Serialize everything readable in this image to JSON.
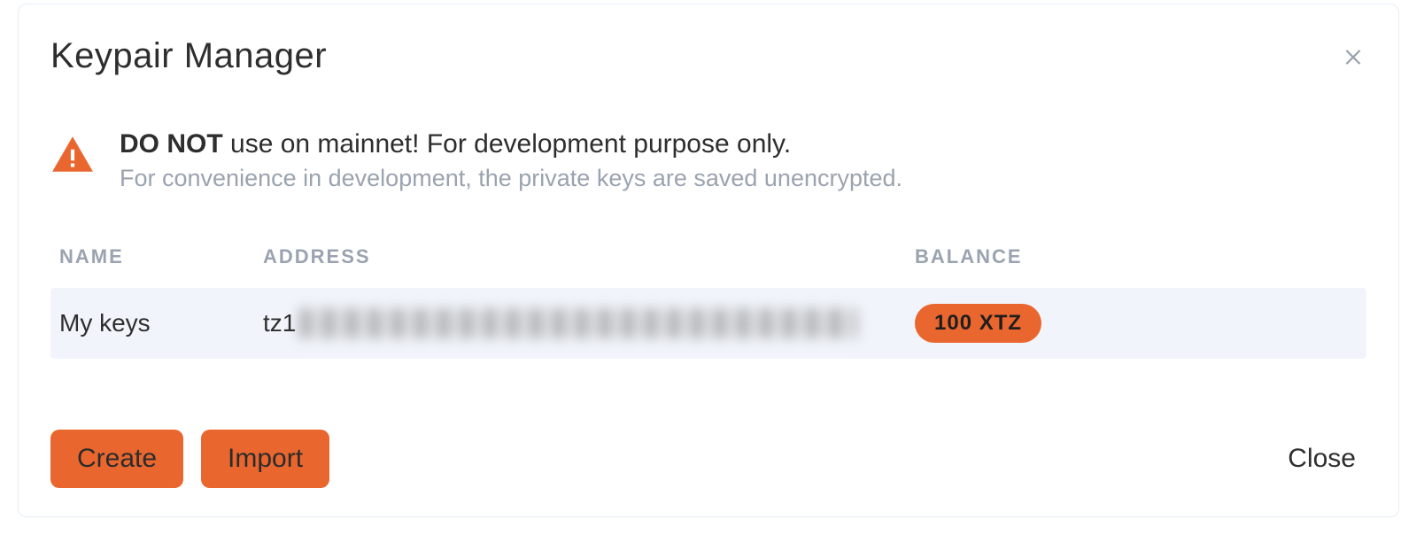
{
  "modal": {
    "title": "Keypair Manager"
  },
  "warning": {
    "bold": "DO NOT",
    "rest": " use on mainnet! For development purpose only.",
    "sub": "For convenience in development, the private keys are saved unencrypted."
  },
  "table": {
    "headers": {
      "name": "NAME",
      "address": "ADDRESS",
      "balance": "BALANCE"
    },
    "rows": [
      {
        "name": "My keys",
        "address_prefix": "tz1",
        "balance": "100 XTZ"
      }
    ]
  },
  "buttons": {
    "create": "Create",
    "import": "Import",
    "close": "Close"
  }
}
